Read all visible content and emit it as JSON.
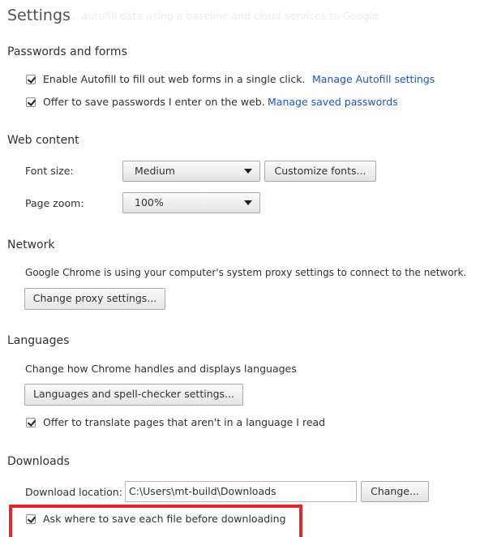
{
  "header": {
    "title": "Settings",
    "faded_text": "... autofill data using a baseline and cloud services to Google"
  },
  "passwords_forms": {
    "title": "Passwords and forms",
    "autofill_label": "Enable Autofill to fill out web forms in a single click.",
    "autofill_link": "Manage Autofill settings",
    "autofill_checked": true,
    "passwords_label": "Offer to save passwords I enter on the web.",
    "passwords_link": "Manage saved passwords",
    "passwords_checked": true
  },
  "web_content": {
    "title": "Web content",
    "font_size_label": "Font size:",
    "font_size_value": "Medium",
    "customize_fonts_button": "Customize fonts...",
    "page_zoom_label": "Page zoom:",
    "page_zoom_value": "100%"
  },
  "network": {
    "title": "Network",
    "description": "Google Chrome is using your computer's system proxy settings to connect to the network.",
    "proxy_button": "Change proxy settings..."
  },
  "languages": {
    "title": "Languages",
    "description": "Change how Chrome handles and displays languages",
    "settings_button": "Languages and spell-checker settings...",
    "translate_label": "Offer to translate pages that aren't in a language I read",
    "translate_checked": true
  },
  "downloads": {
    "title": "Downloads",
    "location_label": "Download location:",
    "location_value": "C:\\Users\\mt-build\\Downloads",
    "change_button": "Change...",
    "ask_label": "Ask where to save each file before downloading",
    "ask_checked": true
  },
  "colors": {
    "link": "#1a55c9",
    "highlight": "#e8242c"
  }
}
